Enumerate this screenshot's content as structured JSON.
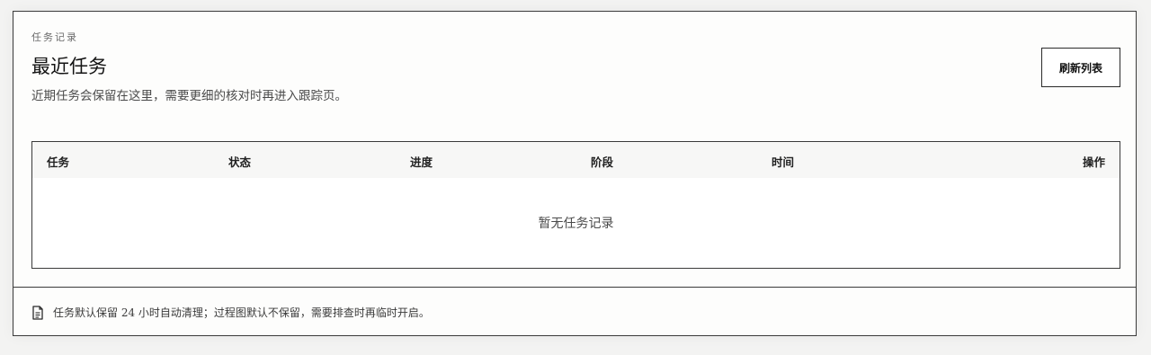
{
  "panel": {
    "eyebrow": "任务记录",
    "title": "最近任务",
    "subtitle": "近期任务会保留在这里，需要更细的核对时再进入跟踪页。",
    "refresh_label": "刷新列表"
  },
  "table": {
    "columns": [
      "任务",
      "状态",
      "进度",
      "阶段",
      "时间",
      "操作"
    ],
    "empty_text": "暂无任务记录"
  },
  "footer": {
    "icon": "document-icon",
    "note": "任务默认保留 24 小时自动清理；过程图默认不保留，需要排查时再临时开启。"
  }
}
